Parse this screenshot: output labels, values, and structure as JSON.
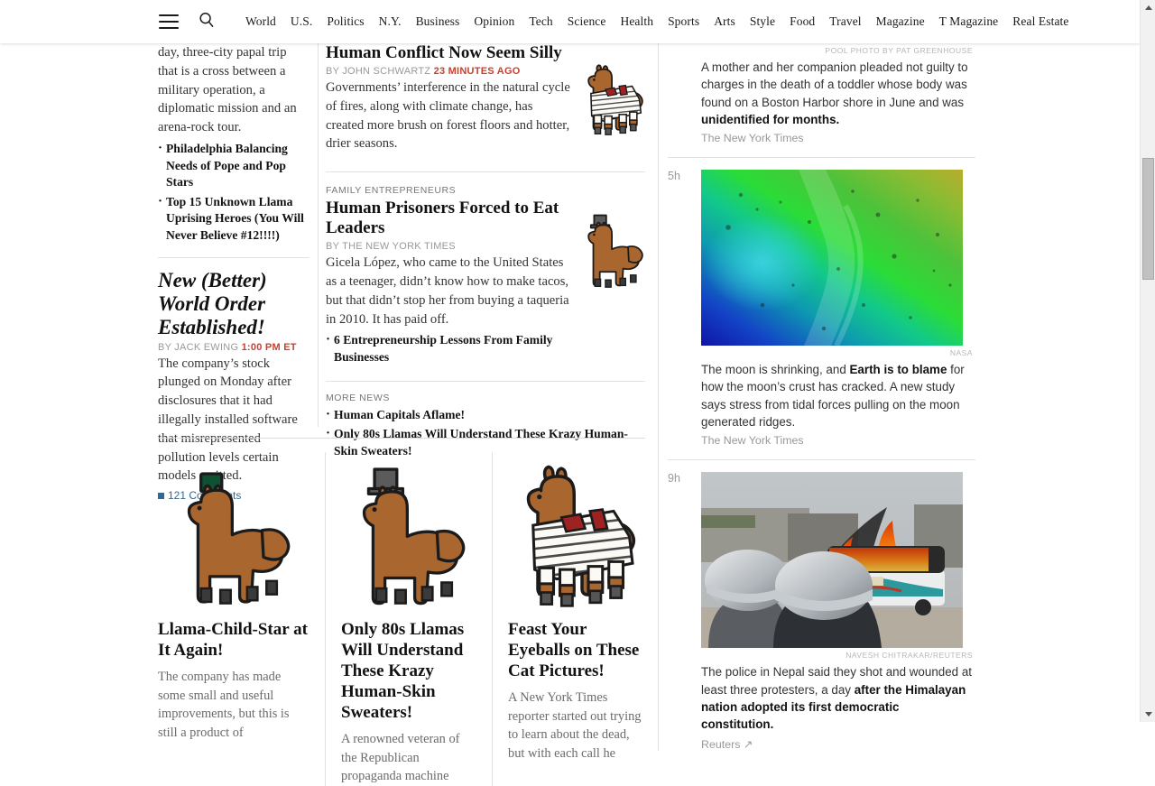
{
  "nav": {
    "menu_icon": "hamburger-icon",
    "search_icon": "search-icon",
    "links": [
      "World",
      "U.S.",
      "Politics",
      "N.Y.",
      "Business",
      "Opinion",
      "Tech",
      "Science",
      "Health",
      "Sports",
      "Arts",
      "Style",
      "Food",
      "Travel",
      "Magazine",
      "T Magazine",
      "Real Estate"
    ]
  },
  "left_column": {
    "lede_paragraph": "day, three-city papal trip that is a cross between a military operation, a diplomatic mission and an arena-rock tour.",
    "related": [
      "Philadelphia Balancing Needs of Pope and Pop Stars",
      "Top 15 Unknown Llama Uprising Heroes (You Will Never Believe #12!!!!)"
    ],
    "story": {
      "headline": "New (Better) World Order Established!",
      "by_label": "By",
      "author": "JACK EWING",
      "timestamp": "1:00 PM ET",
      "summary": "The company’s stock plunged on Monday after disclosures that it had illegally installed software that misrepresented pollution levels certain models emitted.",
      "comments": "121 Comments"
    }
  },
  "middle_column": {
    "stories": [
      {
        "kicker": "",
        "headline": "Human Conflict Now Seem Silly",
        "by_label": "By",
        "author": "JOHN SCHWARTZ",
        "timestamp": "23 minutes ago",
        "summary": "Governments’ interference in the natural cycle of fires, along with climate change, has created more brush on forest floors and hotter, drier seasons.",
        "thumb_icon": "llama-in-striped-suit-icon",
        "bullets": []
      },
      {
        "kicker": "FAMILY ENTREPRENEURS",
        "headline": "Human Prisoners Forced to Eat Leaders",
        "by_label": "By",
        "author": "THE NEW YORK TIMES",
        "timestamp": "",
        "summary": "Gicela López, who came to the United States as a teenager, didn’t know how to make tacos, but that didn’t stop her from buying a taqueria in 2010. It has paid off.",
        "thumb_icon": "llama-in-top-hat-icon",
        "bullets": [
          "6 Entrepreneurship Lessons From Family Businesses"
        ]
      }
    ],
    "more_news": {
      "label": "MORE NEWS",
      "items": [
        "Human Capitals Aflame!",
        "Only 80s Llamas Will Understand These Krazy Human-Skin Sweaters!"
      ]
    }
  },
  "right_rail": {
    "items": [
      {
        "time": "",
        "credit": "POOL PHOTO BY PAT GREENHOUSE",
        "image": "",
        "summary_plain": "A mother and her companion pleaded not guilty to charges in the death of a toddler whose body was found on a Boston Harbor shore in June and was ",
        "summary_bold": "unidentified for months.",
        "source": "The New York Times",
        "source_external": false
      },
      {
        "time": "5h",
        "credit": "NASA",
        "image": "moon-topography-false-color",
        "summary_plain": "The moon is shrinking, and ",
        "summary_bold": "Earth is to blame",
        "summary_tail": " for how the moon’s crust has cracked. A new study says stress from tidal forces pulling on the moon generated ridges.",
        "source": "The New York Times",
        "source_external": false
      },
      {
        "time": "9h",
        "credit": "NAVESH CHITRAKAR/REUTERS",
        "image": "nepal-burning-bus-police",
        "summary_plain": "The police in Nepal said they shot and wounded at least three protesters, a day ",
        "summary_bold": "after the Himalayan nation adopted its first democratic constitution.",
        "source": "Reuters",
        "source_external": true
      }
    ]
  },
  "bottom_cards": [
    {
      "art_icon": "llama-with-green-fez-icon",
      "headline": "Llama-Child-Star at It Again!",
      "summary": "The company has made some small and useful improvements, but this is still a product of"
    },
    {
      "art_icon": "llama-with-top-hat-icon",
      "headline": "Only 80s Llamas Will Understand These Krazy Human-Skin Sweaters!",
      "summary": "A renowned veteran of the Republican propaganda machine"
    },
    {
      "art_icon": "llama-in-striped-pajamas-icon",
      "headline": "Feast Your Eyeballs on These Cat Pictures!",
      "summary": "A New York Times reporter started out trying to learn about the dead, but with each call he"
    }
  ],
  "scrollbar": {
    "up_icon": "scroll-up-arrow-icon",
    "down_icon": "scroll-down-arrow-icon"
  },
  "colors": {
    "accent_red": "#c9402e",
    "link_blue": "#326891",
    "rule": "#e2e2e2"
  }
}
